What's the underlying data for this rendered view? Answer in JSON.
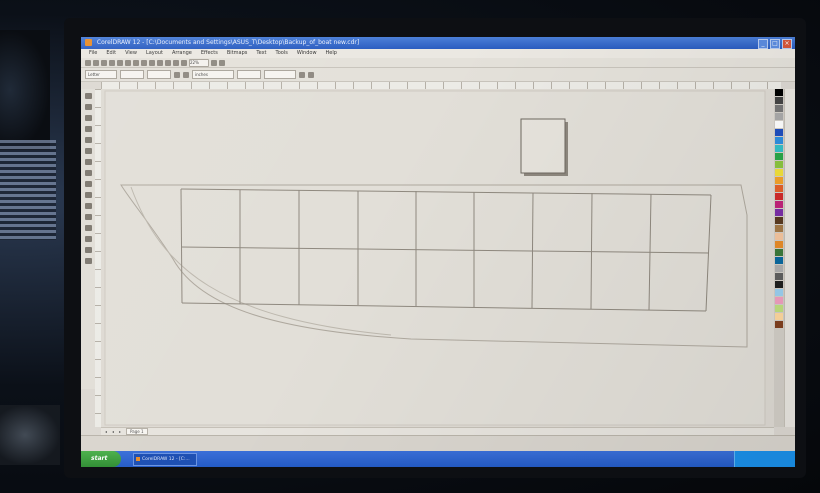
{
  "window": {
    "title": "CorelDRAW 12 - [C:\\Documents and Settings\\ASUS_T\\Desktop\\Backup_of_boat new.cdr]",
    "buttons": {
      "minimize": "_",
      "maximize": "□",
      "close": "×"
    }
  },
  "menu": [
    "File",
    "Edit",
    "View",
    "Layout",
    "Arrange",
    "Effects",
    "Bitmaps",
    "Text",
    "Tools",
    "Window",
    "Help"
  ],
  "toolbar": {
    "zoom_value": "22%"
  },
  "propbar": {
    "paper": "Letter",
    "units": "inches"
  },
  "pagebar": {
    "page_tab": "Page 1"
  },
  "taskbar": {
    "start_label": "start",
    "task_item_label": "CorelDRAW 12 - [C:..."
  },
  "colors": {
    "palette": [
      "#000000",
      "#444444",
      "#777777",
      "#aaaaaa",
      "#ffffff",
      "#1f4fbf",
      "#2f8fe0",
      "#35c0c8",
      "#2aa84a",
      "#8cc63f",
      "#f2e13a",
      "#f4a32a",
      "#e5612a",
      "#d22b2b",
      "#c2237a",
      "#7b2fa8",
      "#5a3a20",
      "#a57a48",
      "#f6c7a0",
      "#e88d2a",
      "#3c7a3c",
      "#0a6aa0",
      "#b0b0b0",
      "#606060",
      "#202020",
      "#9bd0f0",
      "#f0a0c0",
      "#c0e080",
      "#ffd8a0",
      "#804020"
    ],
    "window_title": "#2a5cc0",
    "canvas": "#dedad3"
  }
}
